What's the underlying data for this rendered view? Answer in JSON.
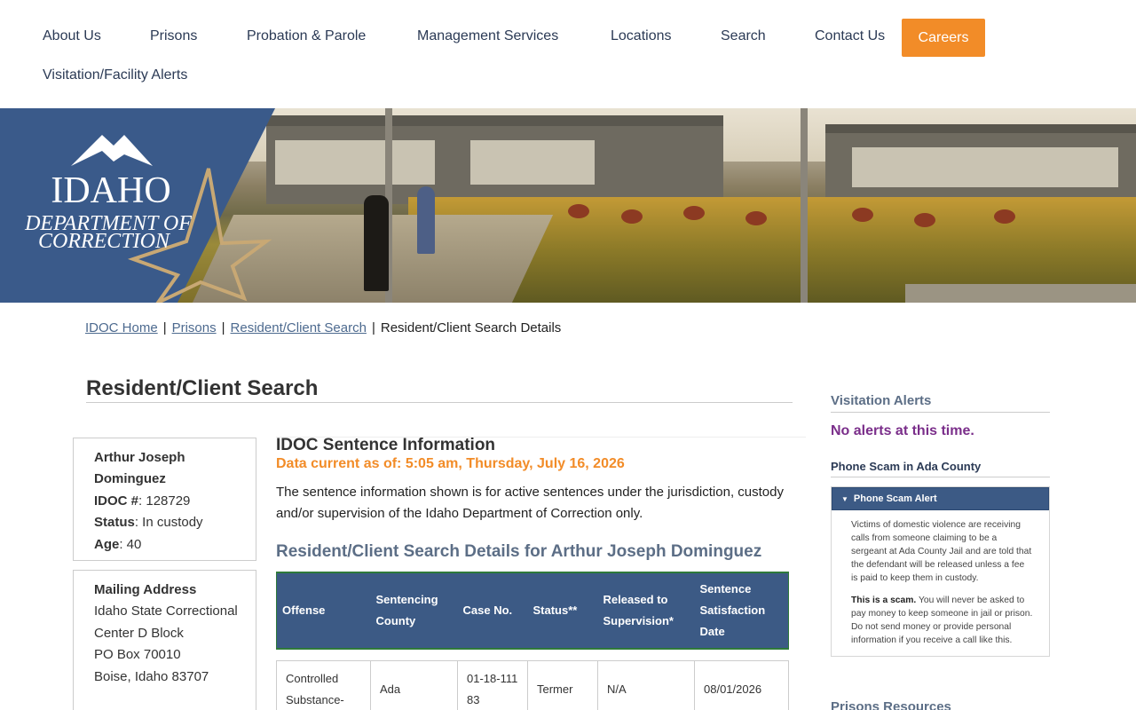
{
  "nav": {
    "items": [
      "About Us",
      "Prisons",
      "Probation & Parole",
      "Management Services",
      "Locations",
      "Search",
      "Contact Us"
    ],
    "careers": "Careers",
    "second_row": "Visitation/Facility Alerts"
  },
  "logo": {
    "line1": "IDAHO",
    "line2": "DEPARTMENT OF",
    "line3": "CORRECTION"
  },
  "breadcrumb": {
    "home": "IDOC Home",
    "prisons": "Prisons",
    "search": "Resident/Client Search",
    "current": "Resident/Client Search Details",
    "separator": "|"
  },
  "page": {
    "title": "Resident/Client Search"
  },
  "person": {
    "name": "Arthur Joseph Dominguez",
    "idoc_label": "IDOC #",
    "idoc": ": 128729",
    "status_label": "Status",
    "status": ": In custody",
    "age_label": "Age",
    "age": ": 40"
  },
  "mailing": {
    "heading": "Mailing Address",
    "line1": "Idaho State Correctional",
    "line2": "Center D Block",
    "line3": "PO Box 70010",
    "line4": "Boise, Idaho 83707"
  },
  "sentence": {
    "title": "IDOC Sentence Information",
    "data_current": "Data current as of: 5:05 am, Thursday, July 16, 2026",
    "intro": "The sentence information shown is for active sentences under the jurisdiction, custody and/or supervision of the Idaho Department of Correction only.",
    "details_title": "Resident/Client Search Details for Arthur Joseph Dominguez"
  },
  "table": {
    "headers": [
      "Offense",
      "Sentencing County",
      "Case No.",
      "Status**",
      "Released to Supervision*",
      "Sentence Satisfaction Date"
    ],
    "rows": [
      [
        "Controlled Substance-",
        "Ada",
        "01-18-11183",
        "Termer",
        "N/A",
        "08/01/2026"
      ]
    ]
  },
  "sidebar": {
    "visitation_heading": "Visitation Alerts",
    "no_alerts": "No alerts at this time.",
    "scam_heading": "Phone Scam in Ada County",
    "accordion_title": "Phone Scam Alert",
    "scam_p1": "Victims of domestic violence are receiving calls from someone claiming to be a sergeant at Ada County Jail and are told that the defendant will be released unless a fee is paid to keep them in custody.",
    "scam_p2_bold": "This is a scam.",
    "scam_p2": " You will never be asked to pay money to keep someone in jail or prison. Do not send money or provide personal information if you receive a call like this.",
    "resources_heading": "Prisons Resources"
  },
  "colors": {
    "accent_orange": "#f28c28",
    "header_blue": "#3c5a85",
    "alert_purple": "#7a2e8a",
    "logo_blue": "#3a5a8a"
  }
}
